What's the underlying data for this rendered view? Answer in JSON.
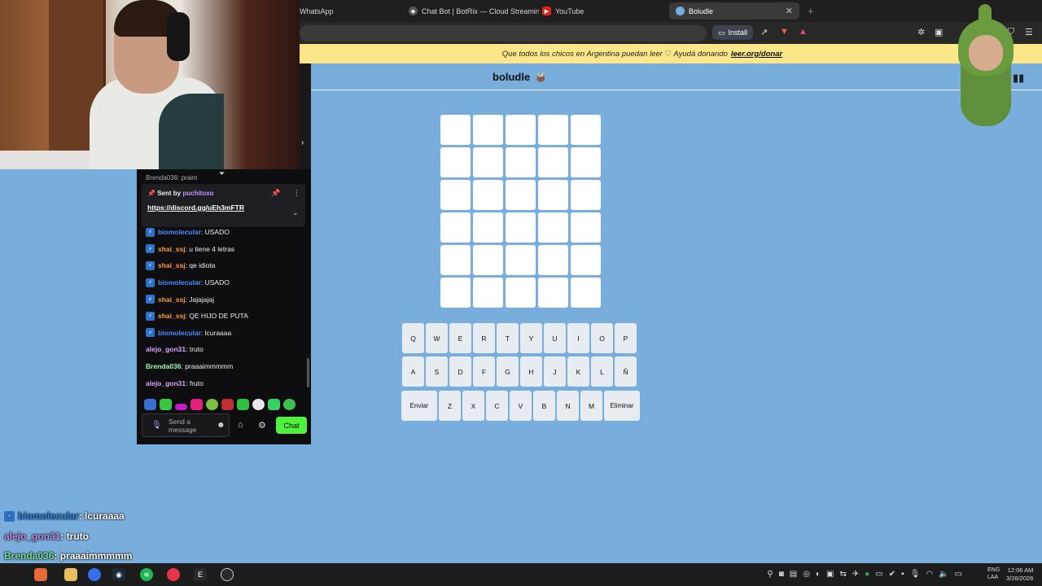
{
  "browser": {
    "tabs": [
      {
        "label": "WhatsApp",
        "icon": "whatsapp-icon"
      },
      {
        "label": "Chat Bot | BotRix — Cloud Streaming",
        "icon": "botrix-icon"
      },
      {
        "label": "YouTube",
        "icon": "youtube-icon"
      },
      {
        "label": "Boludle",
        "icon": "flag-icon",
        "active": true
      }
    ],
    "install_label": "Install"
  },
  "banner": {
    "text": "Que todos los chicos en Argentina puedan leer ♡ Ayudá donando",
    "link": "leer.org/donar"
  },
  "game": {
    "title": "boludle",
    "title_icon": "🧉",
    "rows": 6,
    "cols": 5,
    "keyboard": {
      "row1": [
        "Q",
        "W",
        "E",
        "R",
        "T",
        "Y",
        "U",
        "I",
        "O",
        "P"
      ],
      "row2": [
        "A",
        "S",
        "D",
        "F",
        "G",
        "H",
        "J",
        "K",
        "L",
        "Ñ"
      ],
      "row3": [
        "Enviar",
        "Z",
        "X",
        "C",
        "V",
        "B",
        "N",
        "M",
        "Eliminar"
      ]
    }
  },
  "chat": {
    "partial_top": "Brenda036: praim",
    "pinned": {
      "prefix": "Sent by",
      "user": "puchitoxo",
      "link": "https://discord.gg/uEh3mFTR"
    },
    "messages": [
      {
        "user": "biomolecular",
        "text": ": USADO",
        "color": "#4a8cff",
        "badge": true
      },
      {
        "user": "shai_ssj",
        "text": ": u tiene 4 letras",
        "color": "#ff9a3c",
        "badge": true
      },
      {
        "user": "shai_ssj",
        "text": ": qe idiota",
        "color": "#ff9a3c",
        "badge": true
      },
      {
        "user": "biomolecular",
        "text": ": USADO",
        "color": "#4a8cff",
        "badge": true
      },
      {
        "user": "shai_ssj",
        "text": ": Jajajajaj",
        "color": "#ff9a3c",
        "badge": true
      },
      {
        "user": "shai_ssj",
        "text": ": QE HIJO DE PUTA",
        "color": "#ff9a3c",
        "badge": true
      },
      {
        "user": "biomolecular",
        "text": ": lcuraaaa",
        "color": "#4a8cff",
        "badge": true
      },
      {
        "user": "alejo_gon31",
        "text": ": truto",
        "color": "#d6a6ff",
        "badge": false
      },
      {
        "user": "Brenda036",
        "text": ": praaaimmmmm",
        "color": "#9ef7b4",
        "badge": false
      },
      {
        "user": "alejo_gon31",
        "text": ": fruto",
        "color": "#d6a6ff",
        "badge": false
      }
    ],
    "input_placeholder": "Send a message",
    "chat_button": "Chat"
  },
  "overlay": [
    {
      "user": "biomolecular",
      "text": " : lcuraaaa",
      "color": "#2f87e6",
      "badge": true
    },
    {
      "user": "alejo_gon31",
      "text": " : truto",
      "color": "#c48cf2",
      "badge": false
    },
    {
      "user": "Brenda036",
      "text": " : praaaimmmmm",
      "color": "#7ae0a0",
      "badge": false
    },
    {
      "user": "alejo_gon31",
      "text": " fruto",
      "color": "#c48cf2",
      "badge": false
    }
  ],
  "taskbar": {
    "lang": "ENG",
    "lang2": "LAA",
    "time": "12:06 AM",
    "date": "3/26/2026"
  }
}
